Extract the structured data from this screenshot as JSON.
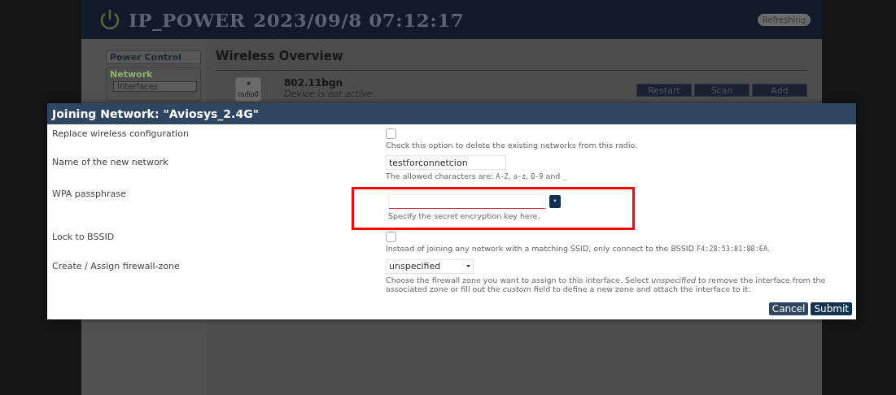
{
  "header": {
    "title": "IP_POWER",
    "datetime": "2023/09/8 07:12:17",
    "badge": "Refreshing"
  },
  "sidebar": {
    "items": [
      {
        "label": "Power Control",
        "selected": false
      },
      {
        "label": "Network",
        "selected": true,
        "children": [
          {
            "label": "Interfaces",
            "selected": true
          }
        ]
      }
    ]
  },
  "content": {
    "title": "Wireless Overview",
    "device": {
      "icon_label": "radio0",
      "name": "802.11bgn",
      "status": "Device is not active"
    },
    "buttons": [
      "Restart",
      "Scan",
      "Add"
    ]
  },
  "dialog": {
    "title": "Joining Network: \"Aviosys_2.4G\"",
    "rows": [
      {
        "kind": "checkbox",
        "label": "Replace wireless configuration",
        "checked": false,
        "highlighted": false,
        "hint": [
          {
            "kind": "text",
            "text": "Check this option to delete the existing networks from this radio."
          }
        ]
      },
      {
        "kind": "text",
        "label": "Name of the new network",
        "value": "testforconnetcion",
        "highlighted": false,
        "hint": [
          {
            "kind": "text",
            "text": "The allowed characters are: "
          },
          {
            "kind": "code",
            "text": "A-Z"
          },
          {
            "kind": "text",
            "text": ", "
          },
          {
            "kind": "code",
            "text": "a-z"
          },
          {
            "kind": "text",
            "text": ", "
          },
          {
            "kind": "code",
            "text": "0-9"
          },
          {
            "kind": "text",
            "text": " and "
          },
          {
            "kind": "code",
            "text": "_"
          }
        ]
      },
      {
        "kind": "password",
        "label": "WPA passphrase",
        "reveal": "*",
        "highlighted": true,
        "hint": [
          {
            "kind": "text",
            "text": "Specify the secret encryption key here."
          }
        ]
      },
      {
        "kind": "checkbox",
        "label": "Lock to BSSID",
        "checked": false,
        "highlighted": false,
        "hint": [
          {
            "kind": "text",
            "text": "Instead of joining any network with a matching SSID, only connect to the BSSID "
          },
          {
            "kind": "code",
            "text": "F4:28:53:81:88:EA"
          },
          {
            "kind": "text",
            "text": "."
          }
        ]
      },
      {
        "kind": "select",
        "label": "Create / Assign firewall-zone",
        "value": "unspecified",
        "highlighted": false,
        "hint": [
          {
            "kind": "text",
            "text": "Choose the firewall zone you want to assign to this interface. Select *unspecified* to remove the interface from the associated zone or fill out the *custom* field to define a new zone and attach the interface to it."
          }
        ]
      }
    ],
    "buttons": [
      {
        "kind": "cancel",
        "label": "Cancel"
      },
      {
        "kind": "submit",
        "label": "Submit"
      }
    ]
  }
}
